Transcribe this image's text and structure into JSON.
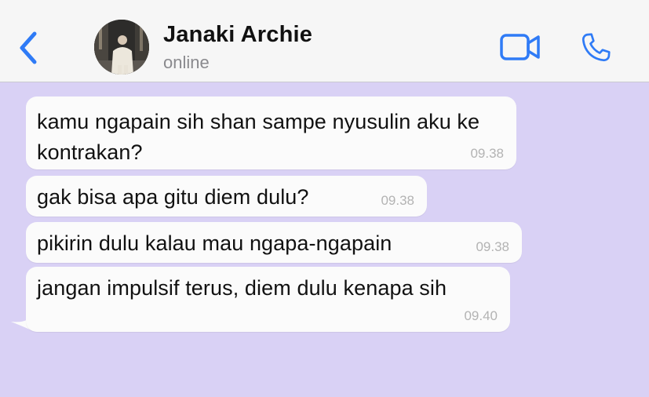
{
  "header": {
    "contact_name": "Janaki Archie",
    "status": "online",
    "icons": {
      "back": "chevron-left-icon",
      "video": "video-camera-icon",
      "call": "phone-icon"
    },
    "accent_color": "#2f7bf6"
  },
  "chat": {
    "background_color": "#d9d1f5",
    "messages": [
      {
        "text": "kamu ngapain sih shan sampe nyusulin aku ke kontrakan?",
        "time": "09.38"
      },
      {
        "text": "gak bisa apa gitu diem dulu?",
        "time": "09.38"
      },
      {
        "text": "pikirin dulu kalau mau ngapa-ngapain",
        "time": "09.38"
      },
      {
        "text": "jangan impulsif terus, diem dulu kenapa sih",
        "time": "09.40"
      }
    ]
  }
}
